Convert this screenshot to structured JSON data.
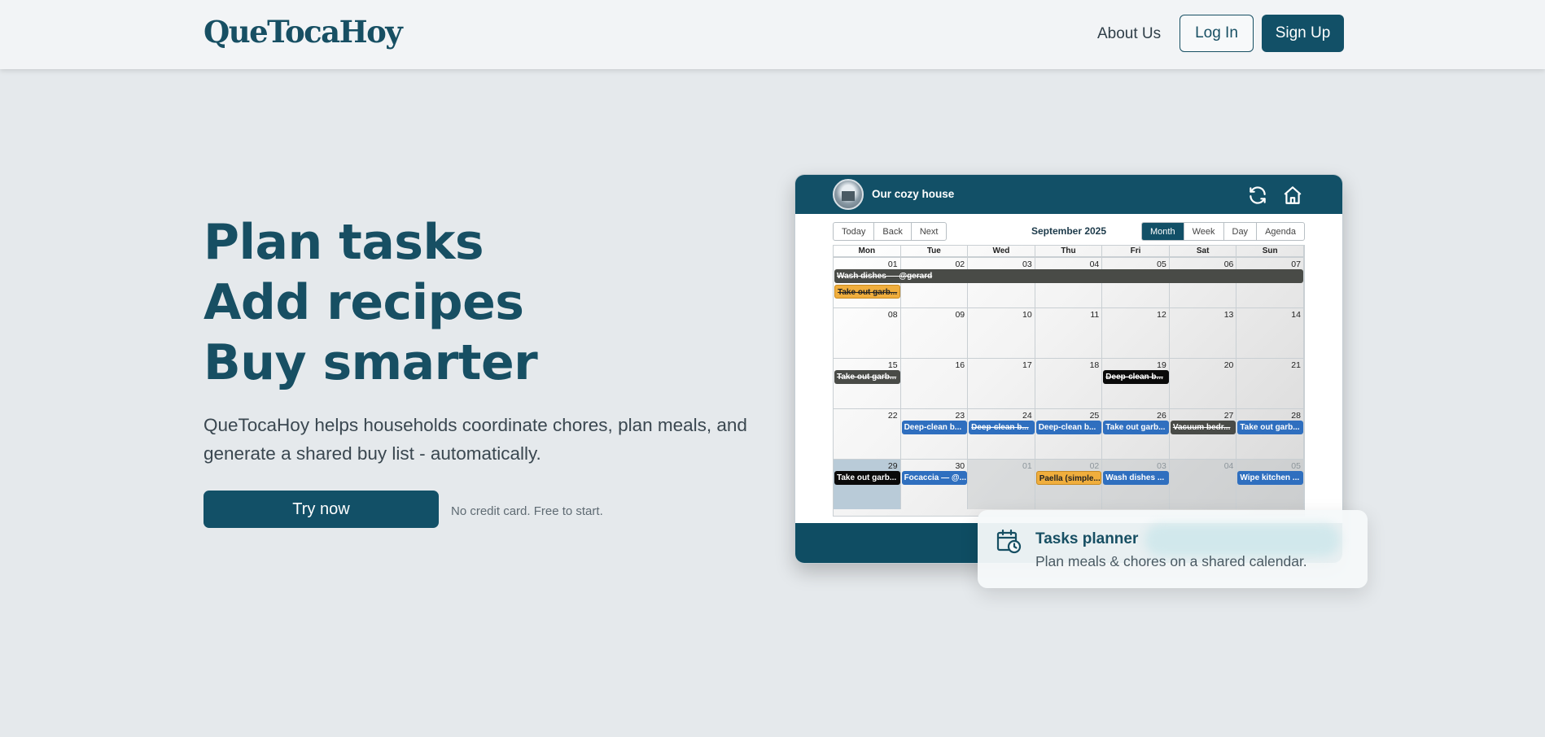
{
  "header": {
    "logo": "QueTocaHoy",
    "nav": {
      "about": "About Us",
      "login": "Log In",
      "signup": "Sign Up"
    }
  },
  "hero": {
    "lines": [
      "Plan tasks",
      "Add recipes",
      "Buy smarter"
    ],
    "description": "QueTocaHoy helps households coordinate chores, plan meals, and generate a shared buy list - automatically.",
    "cta": "Try now",
    "note": "No credit card. Free to start."
  },
  "app": {
    "house_name": "Our cozy house",
    "icons": [
      "refresh-icon",
      "home-icon"
    ],
    "calendar": {
      "nav_buttons": [
        "Today",
        "Back",
        "Next"
      ],
      "title": "September 2025",
      "views": [
        "Month",
        "Week",
        "Day",
        "Agenda"
      ],
      "active_view": "Month",
      "weekdays": [
        "Mon",
        "Tue",
        "Wed",
        "Thu",
        "Fri",
        "Sat",
        "Sun"
      ],
      "weeks": [
        [
          "01",
          "02",
          "03",
          "04",
          "05",
          "06",
          "07"
        ],
        [
          "08",
          "09",
          "10",
          "11",
          "12",
          "13",
          "14"
        ],
        [
          "15",
          "16",
          "17",
          "18",
          "19",
          "20",
          "21"
        ],
        [
          "22",
          "23",
          "24",
          "25",
          "26",
          "27",
          "28"
        ],
        [
          "29",
          "30",
          "01",
          "02",
          "03",
          "04",
          "05"
        ]
      ],
      "events": [
        {
          "label": "Wash dishes — @gerard",
          "week": 0,
          "day": 0,
          "span": 7,
          "row": 0,
          "style": "gray",
          "done": true
        },
        {
          "label": "Take out garb...",
          "week": 0,
          "day": 0,
          "span": 1,
          "row": 1,
          "style": "orange",
          "done": true
        },
        {
          "label": "Take out garb...",
          "week": 2,
          "day": 0,
          "span": 1,
          "row": 0,
          "style": "gray",
          "done": true
        },
        {
          "label": "Deep-clean b...",
          "week": 2,
          "day": 4,
          "span": 1,
          "row": 0,
          "style": "black",
          "done": true
        },
        {
          "label": "Deep-clean b...",
          "week": 3,
          "day": 1,
          "span": 1,
          "row": 0,
          "style": "blue",
          "done": false
        },
        {
          "label": "Deep-clean b...",
          "week": 3,
          "day": 2,
          "span": 1,
          "row": 0,
          "style": "blue",
          "done": true
        },
        {
          "label": "Deep-clean b...",
          "week": 3,
          "day": 3,
          "span": 1,
          "row": 0,
          "style": "blue",
          "done": false
        },
        {
          "label": "Take out garb...",
          "week": 3,
          "day": 4,
          "span": 1,
          "row": 0,
          "style": "blue",
          "done": false
        },
        {
          "label": "Vacuum bedr...",
          "week": 3,
          "day": 5,
          "span": 1,
          "row": 0,
          "style": "gray",
          "done": true
        },
        {
          "label": "Take out garb...",
          "week": 3,
          "day": 6,
          "span": 1,
          "row": 0,
          "style": "blue",
          "done": false
        },
        {
          "label": "Take out garb...",
          "week": 4,
          "day": 0,
          "span": 1,
          "row": 0,
          "style": "black",
          "done": false
        },
        {
          "label": "Focaccia — @...",
          "week": 4,
          "day": 1,
          "span": 1,
          "row": 0,
          "style": "blue",
          "done": false
        },
        {
          "label": "Paella (simple...",
          "week": 4,
          "day": 3,
          "span": 1,
          "row": 0,
          "style": "orange",
          "done": false
        },
        {
          "label": "Wash dishes ...",
          "week": 4,
          "day": 4,
          "span": 1,
          "row": 0,
          "style": "blue",
          "done": false
        },
        {
          "label": "Wipe kitchen ...",
          "week": 4,
          "day": 6,
          "span": 1,
          "row": 0,
          "style": "blue",
          "done": false
        }
      ]
    }
  },
  "feature_card": {
    "icon": "calendar-clock-icon",
    "title": "Tasks planner",
    "subtitle": "Plan meals & chores on a shared calendar."
  }
}
